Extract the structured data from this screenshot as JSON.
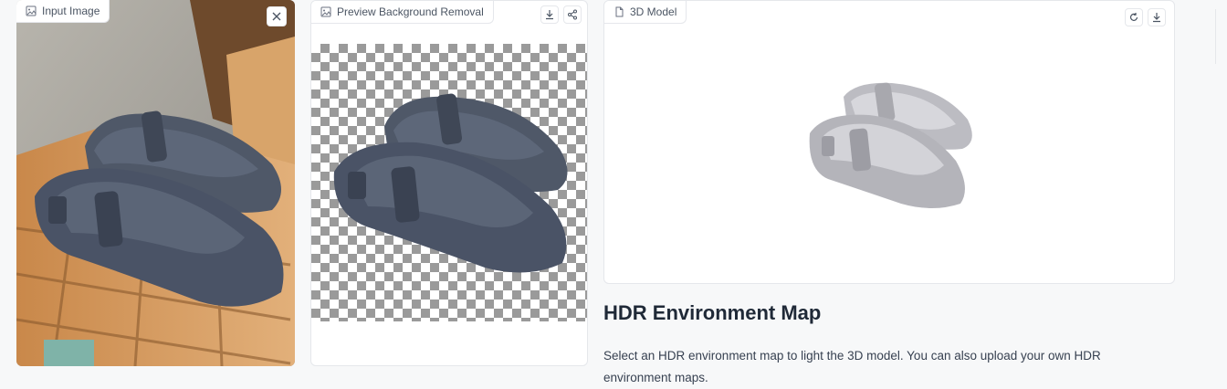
{
  "input_panel": {
    "label": "Input Image",
    "icon": "image-icon",
    "close_icon": "close-icon"
  },
  "preview_panel": {
    "label": "Preview Background Removal",
    "icon": "image-icon",
    "download_icon": "download-icon",
    "share_icon": "share-icon"
  },
  "model_panel": {
    "label": "3D Model",
    "icon": "file-icon",
    "reset_icon": "reset-icon",
    "download_icon": "download-icon"
  },
  "hdr": {
    "title": "HDR Environment Map",
    "description": "Select an HDR environment map to light the 3D model. You can also upload your own HDR environment maps."
  }
}
